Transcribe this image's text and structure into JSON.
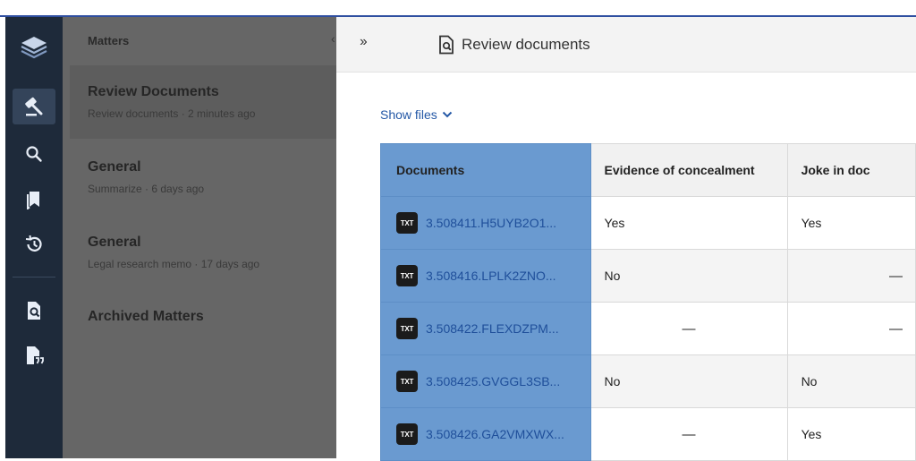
{
  "matters_panel": {
    "title": "Matters",
    "collapse_icon": "chevron-left-icon",
    "items": [
      {
        "title": "Review Documents",
        "subtitle": "Review documents · 2 minutes ago"
      },
      {
        "title": "General",
        "subtitle": "Summarize · 6 days ago"
      },
      {
        "title": "General",
        "subtitle": "Legal research memo · 17 days ago"
      }
    ],
    "archived_label": "Archived Matters"
  },
  "rail": {
    "icons": [
      "logo-stack-icon",
      "gavel-icon",
      "search-icon",
      "bookmarks-icon",
      "history-icon",
      "document-search-icon",
      "document-quote-icon"
    ]
  },
  "main": {
    "expand_icon": "double-chevron-right-icon",
    "title": "Review documents",
    "title_icon": "document-search-icon",
    "show_files_label": "Show files",
    "table": {
      "headers": [
        "Documents",
        "Evidence of concealment",
        "Joke in doc"
      ],
      "rows": [
        {
          "file_type": "TXT",
          "file": "3.508411.H5UYB2O1...",
          "evidence": "Yes",
          "joke": "Yes"
        },
        {
          "file_type": "TXT",
          "file": "3.508416.LPLK2ZNO...",
          "evidence": "No",
          "joke": "—"
        },
        {
          "file_type": "TXT",
          "file": "3.508422.FLEXDZPM...",
          "evidence": "—",
          "joke": "—"
        },
        {
          "file_type": "TXT",
          "file": "3.508425.GVGGL3SB...",
          "evidence": "No",
          "joke": "No"
        },
        {
          "file_type": "TXT",
          "file": "3.508426.GA2VMXWX...",
          "evidence": "—",
          "joke": "Yes"
        }
      ]
    }
  },
  "colors": {
    "rail": "#1e2a3a",
    "overlay_panel": "#666666",
    "documents_column": "#6a9ad0",
    "link": "#1f4f9a",
    "top_accent": "#2f4fa0"
  }
}
